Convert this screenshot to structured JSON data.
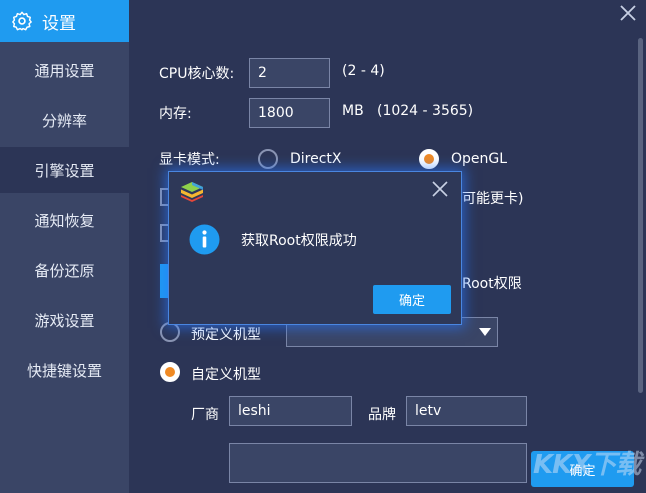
{
  "sidebar": {
    "header_title": "设置",
    "items": [
      {
        "label": "通用设置"
      },
      {
        "label": "分辨率"
      },
      {
        "label": "引擎设置"
      },
      {
        "label": "通知恢复"
      },
      {
        "label": "备份还原"
      },
      {
        "label": "游戏设置"
      },
      {
        "label": "快捷键设置"
      }
    ]
  },
  "engine": {
    "cpu_label": "CPU核心数:",
    "cpu_value": "2",
    "cpu_range": "(2 - 4)",
    "mem_label": "内存:",
    "mem_value": "1800",
    "mem_unit": "MB",
    "mem_range": "(1024 - 3565)",
    "gpu_label": "显卡模式:",
    "gpu_directx": "DirectX",
    "gpu_opengl": "OpenGL",
    "gpu_selected": "OpenGL",
    "partial_checkbox_text": "可能更卡)",
    "partial_root_text": "Root权限",
    "preset_model_label": "预定义机型",
    "custom_model_label": "自定义机型",
    "vendor_label": "厂商",
    "vendor_value": "leshi",
    "brand_label": "品牌",
    "brand_value": "letv",
    "confirm_label": "确定"
  },
  "dialog": {
    "message": "获取Root权限成功",
    "ok_label": "确定"
  },
  "watermark": "KKX下载",
  "colors": {
    "accent": "#1f9bf0",
    "background": "#2c3556",
    "sidebar": "#3a4566",
    "radio_selected": "#f08a24"
  }
}
